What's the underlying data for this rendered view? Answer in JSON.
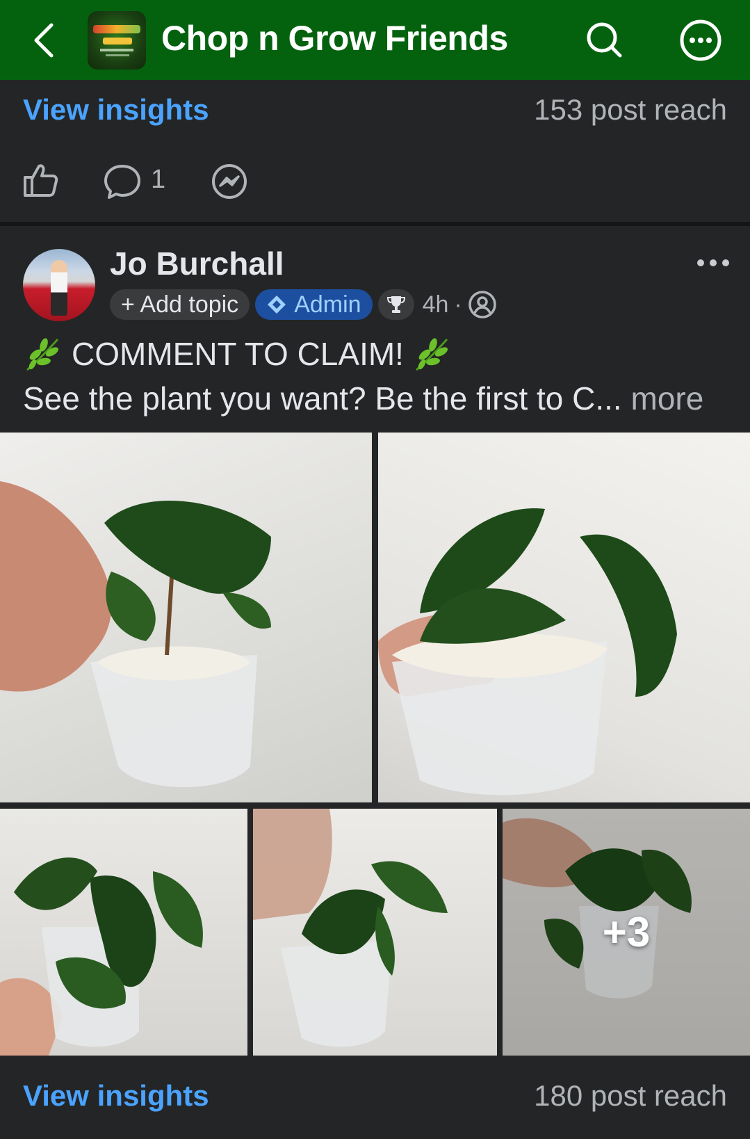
{
  "header": {
    "title": "Chop n Grow Friends",
    "bg_color": "#04620f"
  },
  "post1_footer": {
    "insights_label": "View insights",
    "reach_label": "153 post reach",
    "comment_count": "1"
  },
  "post2": {
    "author": "Jo Burchall",
    "add_topic_label": "+ Add topic",
    "admin_label": "Admin",
    "time": "4h",
    "separator": "·",
    "headline": "COMMENT TO CLAIM!",
    "body_preview": "See the plant you want? Be the first to C...",
    "more_label": "more",
    "extra_photos_label": "+3",
    "insights_label": "View insights",
    "reach_label": "180 post reach"
  },
  "colors": {
    "background": "#242526",
    "link_blue": "#4aa3ff",
    "admin_chip": "#1d4fa0"
  },
  "icons": {
    "back": "chevron-left-icon",
    "search": "search-icon",
    "more": "more-circle-icon",
    "like": "thumbs-up-icon",
    "comment": "comment-bubble-icon",
    "messenger": "messenger-icon",
    "post_more": "ellipsis-icon",
    "trophy": "trophy-icon",
    "privacy": "members-only-icon",
    "herb": "herb-emoji-icon"
  }
}
